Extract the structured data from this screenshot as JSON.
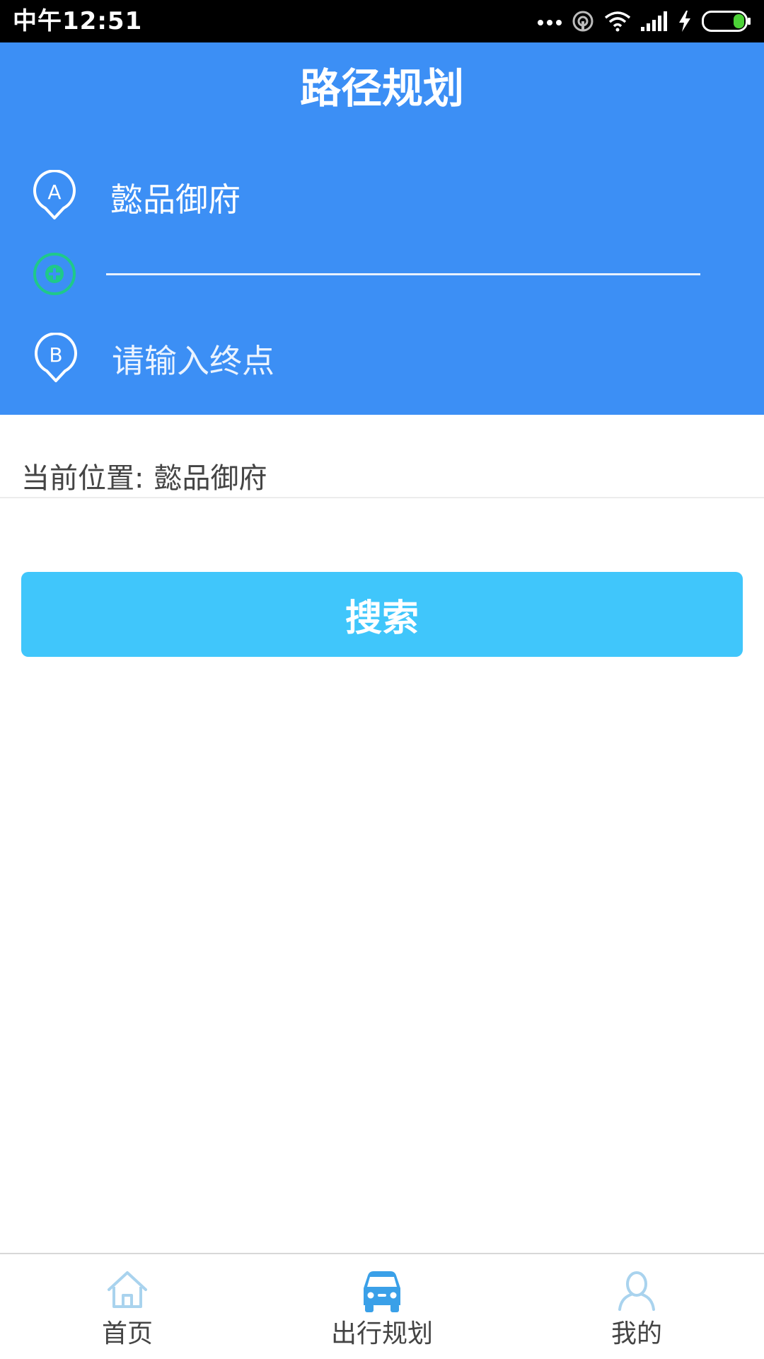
{
  "status_bar": {
    "time": "中午12:51"
  },
  "header": {
    "title": "路径规划",
    "start": {
      "value": "懿品御府",
      "icon": "start-marker-a-icon"
    },
    "waypoint": {
      "icon": "add-waypoint-icon"
    },
    "end": {
      "placeholder": "请输入终点",
      "icon": "end-marker-b-icon"
    }
  },
  "current_location": {
    "label": "当前位置:",
    "value": "懿品御府"
  },
  "search_button": {
    "label": "搜索"
  },
  "bottom_nav": {
    "items": [
      {
        "label": "首页",
        "icon": "home-icon",
        "active": false
      },
      {
        "label": "出行规划",
        "icon": "car-icon",
        "active": true
      },
      {
        "label": "我的",
        "icon": "user-icon",
        "active": false
      }
    ]
  },
  "colors": {
    "header_bg": "#3c8ff5",
    "search_button_bg": "#40c6fb",
    "waypoint_green": "#1fc98a",
    "nav_active": "#3aa0e8",
    "nav_inactive": "#a9d3ee"
  }
}
